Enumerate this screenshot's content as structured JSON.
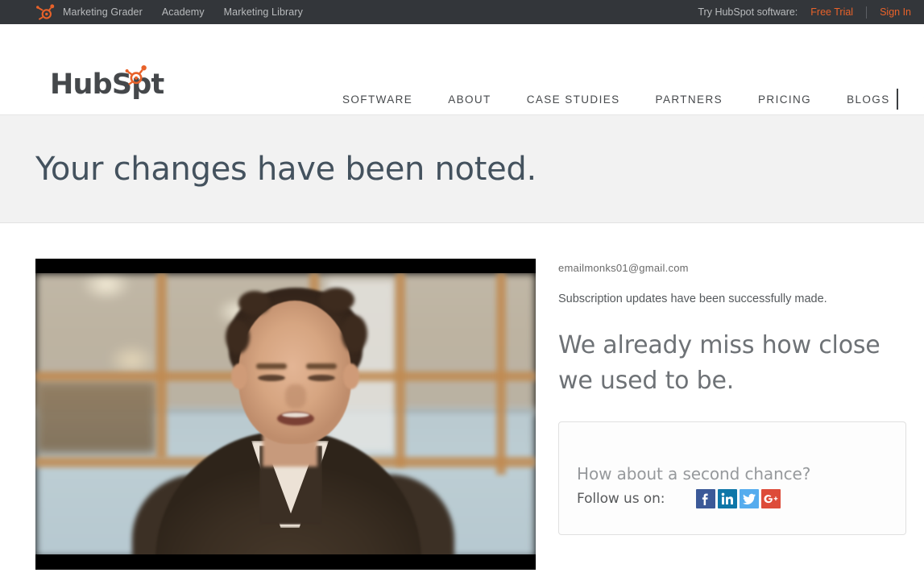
{
  "utility_bar": {
    "logo_icon": "hubspot-sprocket-icon",
    "links": [
      {
        "label": "Marketing Grader"
      },
      {
        "label": "Academy"
      },
      {
        "label": "Marketing Library"
      }
    ],
    "try_label": "Try HubSpot software:",
    "free_trial": "Free Trial",
    "sign_in": "Sign In",
    "background_color": "#33363a",
    "link_color": "#b9bbbd",
    "accent_color": "#e8622a"
  },
  "main_nav": {
    "brand_head": "HubSp",
    "brand_sprocket_icon": "hubspot-sprocket-icon",
    "brand_tail": "t",
    "links": [
      {
        "label": "SOFTWARE"
      },
      {
        "label": "ABOUT"
      },
      {
        "label": "CASE STUDIES"
      },
      {
        "label": "PARTNERS"
      },
      {
        "label": "PRICING"
      },
      {
        "label": "BLOGS"
      }
    ],
    "search_icon": "search-icon",
    "text_color": "#46494c"
  },
  "banner": {
    "title": "Your changes have been noted.",
    "background_color": "#f2f2f2",
    "title_color": "#44525e"
  },
  "main": {
    "video": {
      "name": "testimonial-video-thumbnail",
      "letterboxed": true
    },
    "email": "emailmonks01@gmail.com",
    "status_message": "Subscription updates have been successfully made.",
    "miss_heading": "We already miss how close we used to be.",
    "card": {
      "question": "How about a second chance?",
      "follow_label": "Follow us on:",
      "socials": [
        {
          "name": "facebook",
          "glyph": "f",
          "color": "#3b5998"
        },
        {
          "name": "linkedin",
          "glyph": "in",
          "color": "#0e76a8"
        },
        {
          "name": "twitter",
          "glyph": "twitter-bird-icon",
          "color": "#55acee"
        },
        {
          "name": "googleplus",
          "glyph": "g+",
          "color": "#dd4b39"
        }
      ]
    }
  }
}
